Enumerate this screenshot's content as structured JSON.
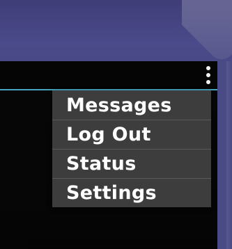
{
  "menu": {
    "items": [
      {
        "label": "Messages"
      },
      {
        "label": "Log Out"
      },
      {
        "label": "Status"
      },
      {
        "label": "Settings"
      }
    ]
  },
  "icons": {
    "overflow": "more-vertical-icon"
  },
  "colors": {
    "frame_purple": "#4b4a8a",
    "appbar_divider": "#4fb7d6",
    "menu_background": "#3d3d3d",
    "menu_text": "#ffffff",
    "screen_background": "#050505"
  }
}
